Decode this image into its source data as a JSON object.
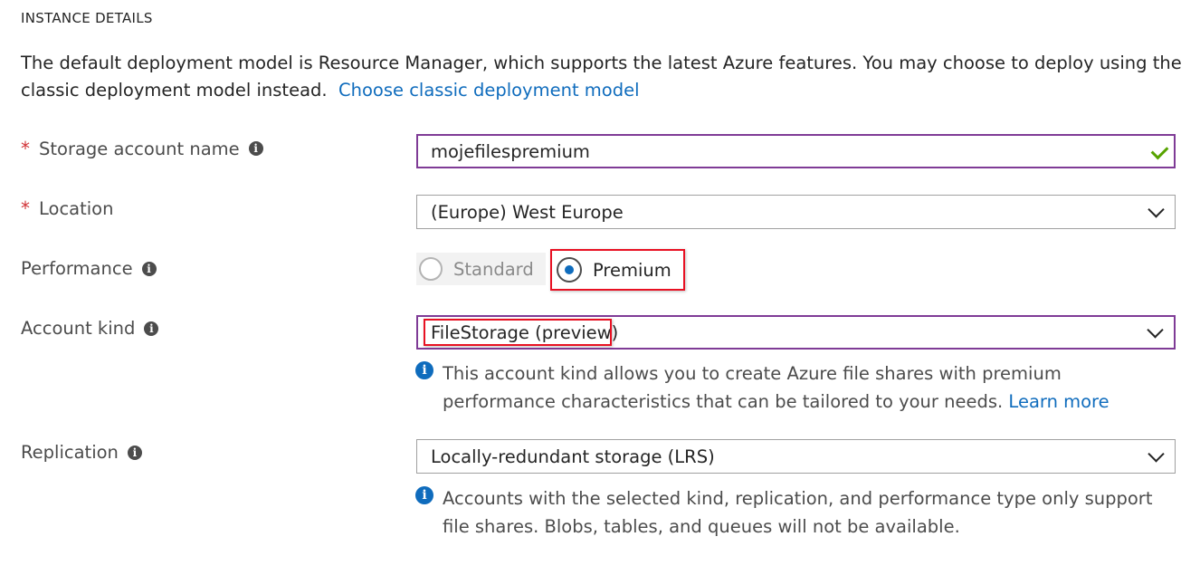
{
  "section_title": "INSTANCE DETAILS",
  "description": {
    "text": "The default deployment model is Resource Manager, which supports the latest Azure features. You may choose to deploy using the classic deployment model instead.",
    "link": "Choose classic deployment model"
  },
  "required_marker": "*",
  "info_glyph": "i",
  "storage_account_name": {
    "label": "Storage account name",
    "value": "mojefilespremium"
  },
  "location": {
    "label": "Location",
    "value": "(Europe) West Europe"
  },
  "performance": {
    "label": "Performance",
    "options": [
      "Standard",
      "Premium"
    ],
    "selected": "Premium"
  },
  "account_kind": {
    "label": "Account kind",
    "value": "FileStorage (preview)",
    "note": "This account kind allows you to create Azure file shares with premium performance characteristics that can be tailored to your needs.",
    "note_link": "Learn more"
  },
  "replication": {
    "label": "Replication",
    "value": "Locally-redundant storage (LRS)",
    "note": "Accounts with the selected kind, replication, and performance type only support file shares. Blobs, tables, and queues will not be available."
  },
  "colors": {
    "accent": "#0f6cbd",
    "required": "#d13438",
    "focus_border": "#7f3b96",
    "highlight": "#e81123",
    "valid": "#57a300"
  }
}
